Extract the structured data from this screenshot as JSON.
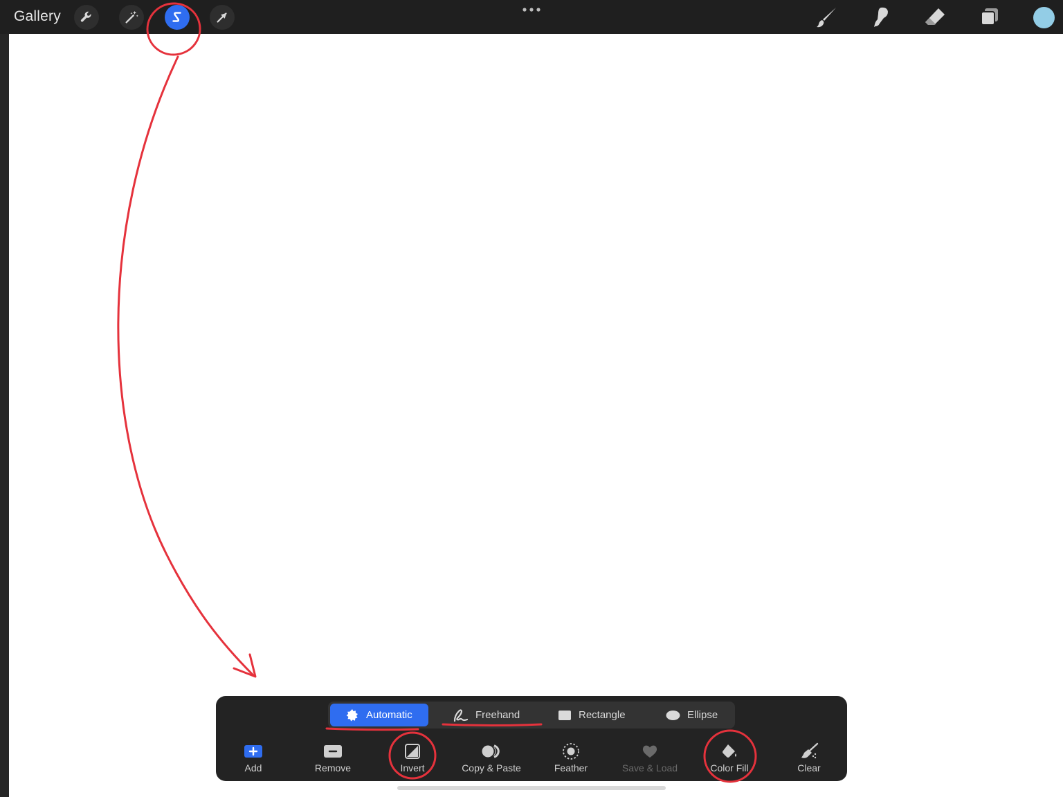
{
  "topbar": {
    "gallery_label": "Gallery",
    "tools": [
      {
        "icon": "wrench-icon"
      },
      {
        "icon": "magic-wand-icon"
      },
      {
        "icon": "selection-icon",
        "active": true
      },
      {
        "icon": "arrow-cursor-icon"
      }
    ],
    "right_tools": [
      {
        "icon": "brush-icon"
      },
      {
        "icon": "smudge-icon"
      },
      {
        "icon": "eraser-icon"
      },
      {
        "icon": "layers-icon"
      }
    ],
    "current_color": "#93cde6"
  },
  "selection_panel": {
    "modes": [
      {
        "label": "Automatic",
        "icon": "automatic-icon",
        "active": true
      },
      {
        "label": "Freehand",
        "icon": "freehand-icon"
      },
      {
        "label": "Rectangle",
        "icon": "rectangle-icon"
      },
      {
        "label": "Ellipse",
        "icon": "ellipse-icon"
      }
    ],
    "actions": [
      {
        "label": "Add",
        "icon": "add-icon"
      },
      {
        "label": "Remove",
        "icon": "remove-icon"
      },
      {
        "label": "Invert",
        "icon": "invert-icon"
      },
      {
        "label": "Copy & Paste",
        "icon": "copy-paste-icon"
      },
      {
        "label": "Feather",
        "icon": "feather-icon"
      },
      {
        "label": "Save & Load",
        "icon": "heart-icon",
        "disabled": true
      },
      {
        "label": "Color Fill",
        "icon": "color-fill-icon"
      },
      {
        "label": "Clear",
        "icon": "clear-icon"
      }
    ]
  },
  "colors": {
    "accent": "#2f6df0",
    "annotation": "#e5323c",
    "bar_bg": "#1f1f1f"
  }
}
